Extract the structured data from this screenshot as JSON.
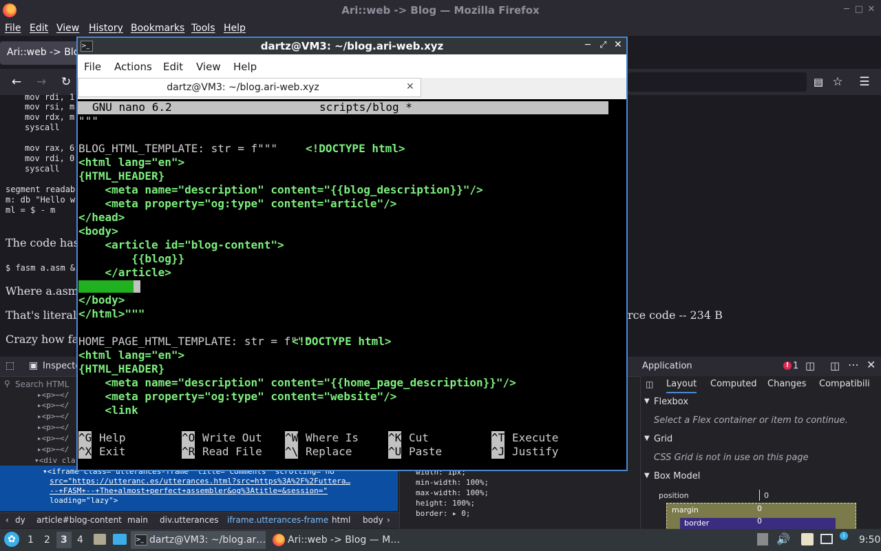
{
  "firefox": {
    "window_title": "Ari::web -> Blog — Mozilla Firefox",
    "menu": [
      "File",
      "Edit",
      "View",
      "History",
      "Bookmarks",
      "Tools",
      "Help"
    ],
    "tab_label": "Ari::web -> Blog",
    "window_controls": [
      "minimize",
      "maximize",
      "close"
    ]
  },
  "page": {
    "code_lines": [
      "mov rdi, 1",
      "mov rsi, m",
      "mov rdx, m",
      "syscall",
      "",
      "mov rax, 6",
      "mov rdi, 0",
      "syscall",
      "",
      "segment readab",
      "m: db \"Hello w",
      "ml = $ - m"
    ],
    "para1": "The code has",
    "cmd": "$ fasm a.asm &",
    "para2": "Where a.asm i",
    "para3": "That's literal",
    "para3_tail": "rce code -- 234 B",
    "para4": "Crazy how fa"
  },
  "devtools": {
    "inspector_tab": "Inspecto",
    "application_tab": "Application",
    "error_count": "1",
    "search_placeholder": "Search HTML",
    "tree_rows": [
      "▸<p>⋯</",
      "▸<p>⋯</",
      "▸<p>⋯</",
      "▸<p>⋯</",
      "▸<p>⋯</",
      "▸<p>⋯</",
      "▾<div cla"
    ],
    "selected_lines": [
      "▾<iframe class=\"utterances-frame\" title=\"Comments\" scrolling=\"no\"",
      "src=\"https://utteranc.es/utterances.html?src=https%3A%2F%2Futtera…",
      "--+FASM+--+The+almost+perfect+assembler&og%3Atitle=&session=\"",
      "loading=\"lazy\">"
    ],
    "rules": [
      "width: 1px;",
      "min-width: 100%;",
      "max-width: 100%;",
      "height: 100%;",
      "border: ▸ 0;"
    ],
    "right_tabs": [
      "Layout",
      "Computed",
      "Changes",
      "Compatibili"
    ],
    "flexbox_header": "Flexbox",
    "flexbox_text": "Select a Flex container or item to continue.",
    "grid_header": "Grid",
    "grid_text": "CSS Grid is not in use on this page",
    "boxmodel_header": "Box Model",
    "position_label": "position",
    "position_value": "0",
    "margin_label": "margin",
    "margin_value": "0",
    "border_label": "border",
    "border_value": "0",
    "breadcrumbs": [
      "dy",
      "article#blog-content",
      "main",
      "div.utterances",
      "iframe.utterances-frame",
      "html",
      "body"
    ]
  },
  "terminal": {
    "title": "dartz@VM3: ~/blog.ari-web.xyz",
    "menu": [
      "File",
      "Actions",
      "Edit",
      "View",
      "Help"
    ],
    "tab_label": "dartz@VM3: ~/blog.ari-web.xyz",
    "nano_version": "GNU nano 6.2",
    "nano_file": "scripts/blog *",
    "lines": [
      {
        "text": "\"\"\"",
        "style": "white"
      },
      {
        "text": "",
        "style": "white"
      },
      {
        "text": "BLOG_HTML_TEMPLATE: str = f\"\"\"",
        "style": "white",
        "tail": "<!DOCTYPE html>"
      },
      {
        "text": "<html lang=\"en\">",
        "style": "green"
      },
      {
        "text": "{HTML_HEADER}",
        "style": "green"
      },
      {
        "text": "    <meta name=\"description\" content=\"{{blog_description}}\"/>",
        "style": "green"
      },
      {
        "text": "    <meta property=\"og:type\" content=\"article\"/>",
        "style": "green"
      },
      {
        "text": "</head>",
        "style": "green"
      },
      {
        "text": "<body>",
        "style": "green"
      },
      {
        "text": "    <article id=\"blog-content\">",
        "style": "green"
      },
      {
        "text": "        {{blog}}",
        "style": "green"
      },
      {
        "text": "    </article>",
        "style": "green"
      },
      {
        "text": "",
        "style": "green"
      },
      {
        "text": "</body>",
        "style": "green"
      },
      {
        "text": "</html>\"\"\"",
        "style": "green"
      },
      {
        "text": "",
        "style": "white"
      },
      {
        "text": "HOME_PAGE_HTML_TEMPLATE: str = f\"\"\"",
        "style": "white",
        "tail": "<!DOCTYPE html>"
      },
      {
        "text": "<html lang=\"en\">",
        "style": "green"
      },
      {
        "text": "{HTML_HEADER}",
        "style": "green"
      },
      {
        "text": "    <meta name=\"description\" content=\"{{home_page_description}}\"/>",
        "style": "green"
      },
      {
        "text": "    <meta property=\"og:type\" content=\"website\"/>",
        "style": "green"
      },
      {
        "text": "    <link",
        "style": "green"
      }
    ],
    "shortcuts": [
      {
        "key": "^G",
        "label": "Help"
      },
      {
        "key": "^O",
        "label": "Write Out"
      },
      {
        "key": "^W",
        "label": "Where Is"
      },
      {
        "key": "^K",
        "label": "Cut"
      },
      {
        "key": "^T",
        "label": "Execute"
      },
      {
        "key": "^X",
        "label": "Exit"
      },
      {
        "key": "^R",
        "label": "Read File"
      },
      {
        "key": "^\\",
        "label": "Replace"
      },
      {
        "key": "^U",
        "label": "Paste"
      },
      {
        "key": "^J",
        "label": "Justify"
      }
    ]
  },
  "taskbar": {
    "desktops": [
      "1",
      "2",
      "3",
      "4"
    ],
    "task_terminal": "dartz@VM3: ~/blog.ar…",
    "task_firefox": "Ari::web -> Blog — M…",
    "clock": "9:50"
  },
  "colors": {
    "accent": "#4a8bd6",
    "nano_green": "#7ef07e",
    "selection": "#0b4ea2"
  }
}
